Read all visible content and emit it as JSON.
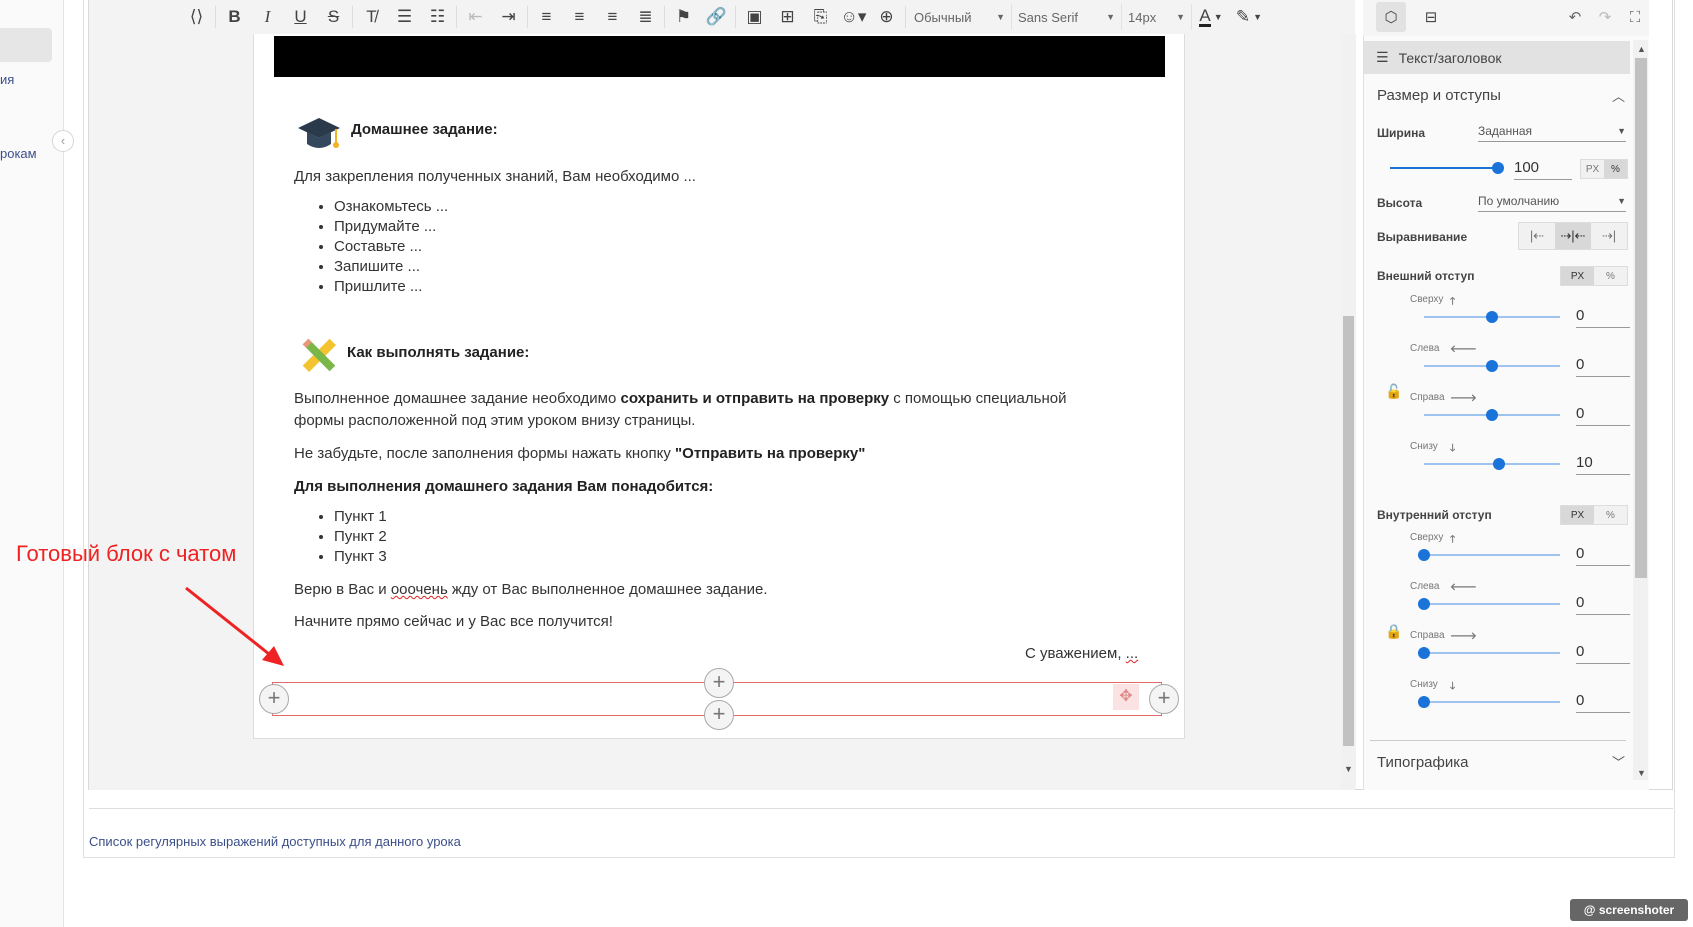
{
  "sidebar": {
    "items": [
      {
        "label": "ия"
      },
      {
        "label": "рокам"
      }
    ],
    "collapse_icon": "chevron-left-icon"
  },
  "toolbar": {
    "buttons": [
      "code-view-icon",
      "bold-icon",
      "italic-icon",
      "underline-icon",
      "strikethrough-icon",
      "clear-format-icon",
      "ordered-list-icon",
      "bullet-list-icon",
      "outdent-icon",
      "indent-icon",
      "align-left-icon",
      "align-center-icon",
      "align-right-icon",
      "justify-icon",
      "flag-add-icon",
      "link-icon",
      "image-icon",
      "table-icon",
      "file-icon",
      "emoji-icon",
      "globe-icon"
    ],
    "style_select": "Обычный",
    "font_select": "Sans Serif",
    "size_select": "14px"
  },
  "document": {
    "heading1": "Домашнее задание:",
    "intro": "Для закрепления полученных знаний, Вам необходимо ...",
    "list1": [
      "Ознакомьтесь ...",
      "Придумайте ...",
      "Составьте ...",
      "Запишите ...",
      "Пришлите ..."
    ],
    "heading2": "Как выполнять задание:",
    "para1_pre": "Выполненное домашнее задание необходимо ",
    "para1_bold": "сохранить и отправить на проверку",
    "para1_post": " с помощью специальной",
    "para1_line2": "формы расположенной под этим уроком внизу страницы.",
    "para2_pre": "Не забудьте, после заполнения формы нажать кнопку ",
    "para2_bold": "\"Отправить на проверку\"",
    "para3": "Для выполнения домашнего задания Вам понадобится:",
    "list2": [
      "Пункт 1",
      "Пункт 2",
      "Пункт 3"
    ],
    "para4_pre": "Верю в Вас и ",
    "para4_err": "ооочень",
    "para4_post": " жду от Вас выполненное домашнее задание.",
    "para5": "Начните прямо сейчас и у Вас все получится!",
    "signature": "С уважением, ",
    "signature_err": "..."
  },
  "annotation": {
    "text": "Готовый блок с чатом",
    "color": "#ee2222"
  },
  "panel": {
    "header": "Текст/заголовок",
    "section_size": "Размер и отступы",
    "width_label": "Ширина",
    "width_mode": "Заданная",
    "width_value": "100",
    "width_value_fraction": 1.0,
    "unit_px": "PX",
    "unit_pct": "%",
    "height_label": "Высота",
    "height_mode": "По умолчанию",
    "align_label": "Выравнивание",
    "margin_label": "Внешний отступ",
    "margin": [
      {
        "label": "Сверху",
        "arrow": "🡑",
        "value": "0",
        "level": 0.5
      },
      {
        "label": "Слева",
        "arrow": "🡐",
        "value": "0",
        "level": 0.5
      },
      {
        "label": "Справа",
        "arrow": "🡒",
        "value": "0",
        "level": 0.5
      },
      {
        "label": "Снизу",
        "arrow": "🡓",
        "value": "10",
        "level": 0.55
      }
    ],
    "padding_label": "Внутренний отступ",
    "padding": [
      {
        "label": "Сверху",
        "arrow": "🡑",
        "value": "0",
        "level": 0
      },
      {
        "label": "Слева",
        "arrow": "🡐",
        "value": "0",
        "level": 0
      },
      {
        "label": "Справа",
        "arrow": "🡒",
        "value": "0",
        "level": 0
      },
      {
        "label": "Снизу",
        "arrow": "🡓",
        "value": "0",
        "level": 0
      }
    ],
    "section_typography": "Типографика",
    "accent": "#1a73d9"
  },
  "footer": {
    "link": "Список регулярных выражений доступных для данного урока"
  },
  "watermark": "@ screenshoter"
}
